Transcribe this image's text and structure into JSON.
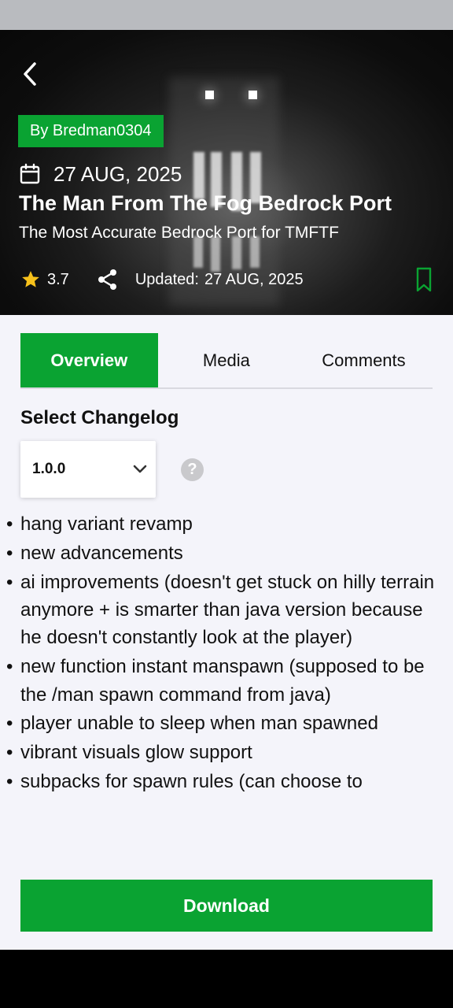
{
  "hero": {
    "author": "By Bredman0304",
    "date": "27 AUG, 2025",
    "title": "The Man From The Fog Bedrock Port",
    "subtitle": "The Most Accurate Bedrock Port for TMFTF",
    "rating": "3.7",
    "updated_label": "Updated:",
    "updated_date": "27 AUG, 2025"
  },
  "tabs": [
    "Overview",
    "Media",
    "Comments"
  ],
  "active_tab": "Overview",
  "changelog": {
    "title": "Select Changelog",
    "selected_version": "1.0.0",
    "items": [
      "hang variant revamp",
      "new advancements",
      "ai improvements (doesn't get stuck on hilly terrain anymore + is smarter than java version because he doesn't constantly look at the player)",
      "new function instant manspawn (supposed to be the /man spawn command from java)",
      "player unable to sleep when man spawned",
      "vibrant visuals glow support",
      "subpacks for spawn rules (can choose to"
    ]
  },
  "download_label": "Download",
  "colors": {
    "accent": "#0aa332",
    "background": "#f4f4fa",
    "status_bar": "#b9bbbf",
    "star": "#f7c11b"
  }
}
